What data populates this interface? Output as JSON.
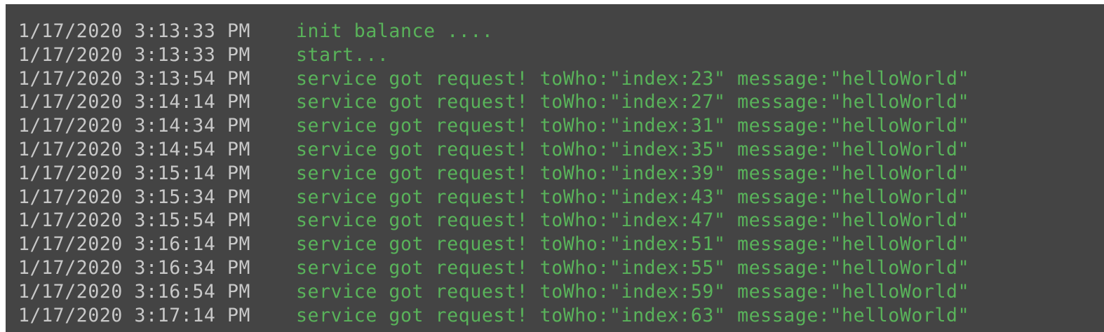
{
  "colors": {
    "background": "#444444",
    "timestamp": "#c8c8c8",
    "message": "#59b35a"
  },
  "log": {
    "lines": [
      {
        "timestamp": "1/17/2020 3:13:33 PM",
        "message": "init balance ...."
      },
      {
        "timestamp": "1/17/2020 3:13:33 PM",
        "message": "start..."
      },
      {
        "timestamp": "1/17/2020 3:13:54 PM",
        "message": "service got request! toWho:\"index:23\" message:\"helloWorld\""
      },
      {
        "timestamp": "1/17/2020 3:14:14 PM",
        "message": "service got request! toWho:\"index:27\" message:\"helloWorld\""
      },
      {
        "timestamp": "1/17/2020 3:14:34 PM",
        "message": "service got request! toWho:\"index:31\" message:\"helloWorld\""
      },
      {
        "timestamp": "1/17/2020 3:14:54 PM",
        "message": "service got request! toWho:\"index:35\" message:\"helloWorld\""
      },
      {
        "timestamp": "1/17/2020 3:15:14 PM",
        "message": "service got request! toWho:\"index:39\" message:\"helloWorld\""
      },
      {
        "timestamp": "1/17/2020 3:15:34 PM",
        "message": "service got request! toWho:\"index:43\" message:\"helloWorld\""
      },
      {
        "timestamp": "1/17/2020 3:15:54 PM",
        "message": "service got request! toWho:\"index:47\" message:\"helloWorld\""
      },
      {
        "timestamp": "1/17/2020 3:16:14 PM",
        "message": "service got request! toWho:\"index:51\" message:\"helloWorld\""
      },
      {
        "timestamp": "1/17/2020 3:16:34 PM",
        "message": "service got request! toWho:\"index:55\" message:\"helloWorld\""
      },
      {
        "timestamp": "1/17/2020 3:16:54 PM",
        "message": "service got request! toWho:\"index:59\" message:\"helloWorld\""
      },
      {
        "timestamp": "1/17/2020 3:17:14 PM",
        "message": "service got request! toWho:\"index:63\" message:\"helloWorld\""
      }
    ]
  }
}
